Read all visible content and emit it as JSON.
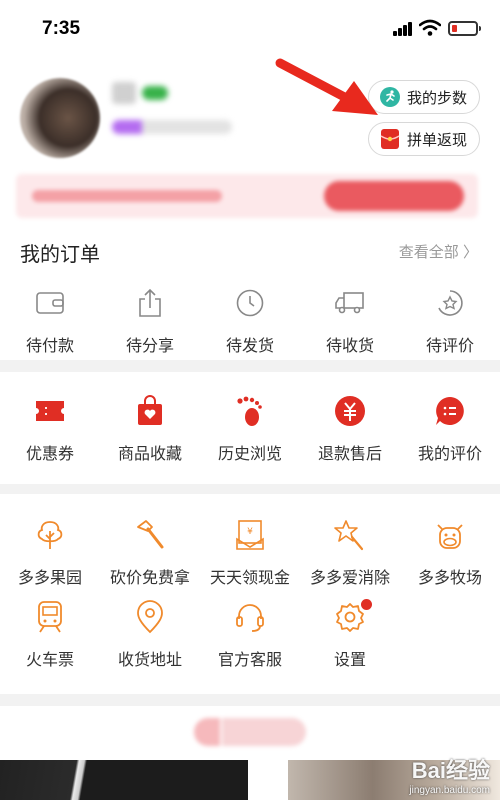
{
  "status": {
    "time": "7:35"
  },
  "profile": {
    "steps_button": "我的步数",
    "group_button": "拼单返现"
  },
  "orders": {
    "title": "我的订单",
    "view_all": "查看全部",
    "items": [
      {
        "label": "待付款",
        "icon": "wallet-icon"
      },
      {
        "label": "待分享",
        "icon": "share-icon"
      },
      {
        "label": "待发货",
        "icon": "clock-icon"
      },
      {
        "label": "待收货",
        "icon": "truck-icon"
      },
      {
        "label": "待评价",
        "icon": "review-icon"
      }
    ]
  },
  "quick": {
    "items": [
      {
        "label": "优惠券",
        "icon": "coupon-icon"
      },
      {
        "label": "商品收藏",
        "icon": "favorite-bag-icon"
      },
      {
        "label": "历史浏览",
        "icon": "footprint-icon"
      },
      {
        "label": "退款售后",
        "icon": "refund-icon"
      },
      {
        "label": "我的评价",
        "icon": "comment-icon"
      }
    ]
  },
  "games": {
    "row1": [
      {
        "label": "多多果园",
        "icon": "tree-icon"
      },
      {
        "label": "砍价免费拿",
        "icon": "axe-icon"
      },
      {
        "label": "天天领现金",
        "icon": "cash-envelope-icon"
      },
      {
        "label": "多多爱消除",
        "icon": "star-wand-icon"
      },
      {
        "label": "多多牧场",
        "icon": "cow-icon"
      }
    ],
    "row2": [
      {
        "label": "火车票",
        "icon": "train-icon"
      },
      {
        "label": "收货地址",
        "icon": "location-icon"
      },
      {
        "label": "官方客服",
        "icon": "headset-icon"
      },
      {
        "label": "设置",
        "icon": "settings-icon"
      }
    ]
  },
  "colors": {
    "accent": "#e02e24",
    "orange": "#f08a2c",
    "gray_icon": "#888888"
  },
  "watermark": {
    "logo": "Bai经验",
    "url": "jingyan.baidu.com"
  }
}
